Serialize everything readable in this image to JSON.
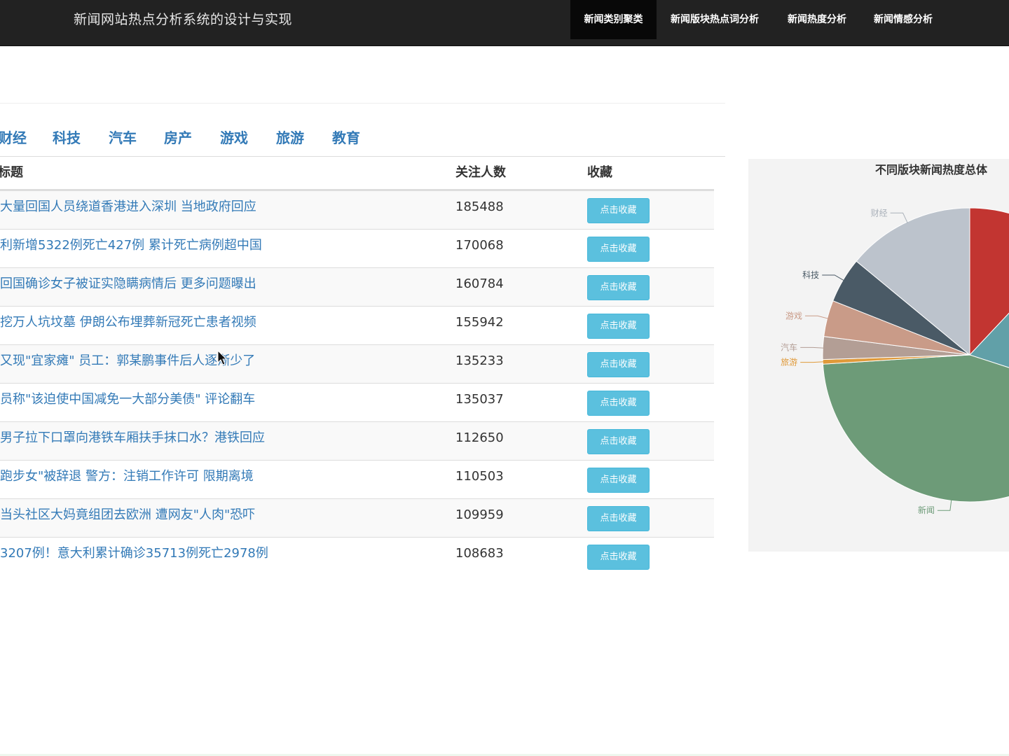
{
  "header": {
    "brand": "新闻网站热点分析系统的设计与实现",
    "nav": [
      {
        "label": "新闻类别聚类",
        "active": true
      },
      {
        "label": "新闻版块热点词分析",
        "active": false
      },
      {
        "label": "新闻热度分析",
        "active": false
      },
      {
        "label": "新闻情感分析",
        "active": false
      }
    ]
  },
  "tabs": [
    "财经",
    "科技",
    "汽车",
    "房产",
    "游戏",
    "旅游",
    "教育"
  ],
  "table": {
    "columns": [
      "标题",
      "关注人数",
      "收藏"
    ],
    "button_label": "点击收藏",
    "rows": [
      {
        "title": "大量回国人员绕道香港进入深圳 当地政府回应",
        "count": "185488"
      },
      {
        "title": "利新增5322例死亡427例 累计死亡病例超中国",
        "count": "170068"
      },
      {
        "title": "回国确诊女子被证实隐瞒病情后 更多问题曝出",
        "count": "160784"
      },
      {
        "title": "挖万人坑坟墓 伊朗公布埋葬新冠死亡患者视频",
        "count": "155942"
      },
      {
        "title": "又现\"宜家瘫\" 员工：郭某鹏事件后人逐渐少了",
        "count": "135233"
      },
      {
        "title": "员称\"该迫使中国减免一大部分美债\" 评论翻车",
        "count": "135037"
      },
      {
        "title": "男子拉下口罩向港铁车厢扶手抹口水？港铁回应",
        "count": "112650"
      },
      {
        "title": "跑步女\"被辞退 警方：注销工作许可 限期离境",
        "count": "110503"
      },
      {
        "title": "当头社区大妈竟组团去欧洲 遭网友\"人肉\"恐吓",
        "count": "109959"
      },
      {
        "title": "3207例！意大利累计确诊35713例死亡2978例",
        "count": "108683"
      }
    ]
  },
  "chart_data": {
    "type": "pie",
    "title": "不同版块新闻热度总体",
    "slices": [
      {
        "name": "",
        "value": 12,
        "color": "#c23531"
      },
      {
        "name": "",
        "value": 18,
        "color": "#61a0a8"
      },
      {
        "name": "新闻",
        "value": 44,
        "color": "#6d9b78"
      },
      {
        "name": "旅游",
        "value": 0.5,
        "color": "#e09a3a"
      },
      {
        "name": "汽车",
        "value": 2.5,
        "color": "#b39e95"
      },
      {
        "name": "游戏",
        "value": 4,
        "color": "#c99b88"
      },
      {
        "name": "科技",
        "value": 5,
        "color": "#4a5a66"
      },
      {
        "name": "财经",
        "value": 14,
        "color": "#bcc3cc"
      }
    ]
  }
}
